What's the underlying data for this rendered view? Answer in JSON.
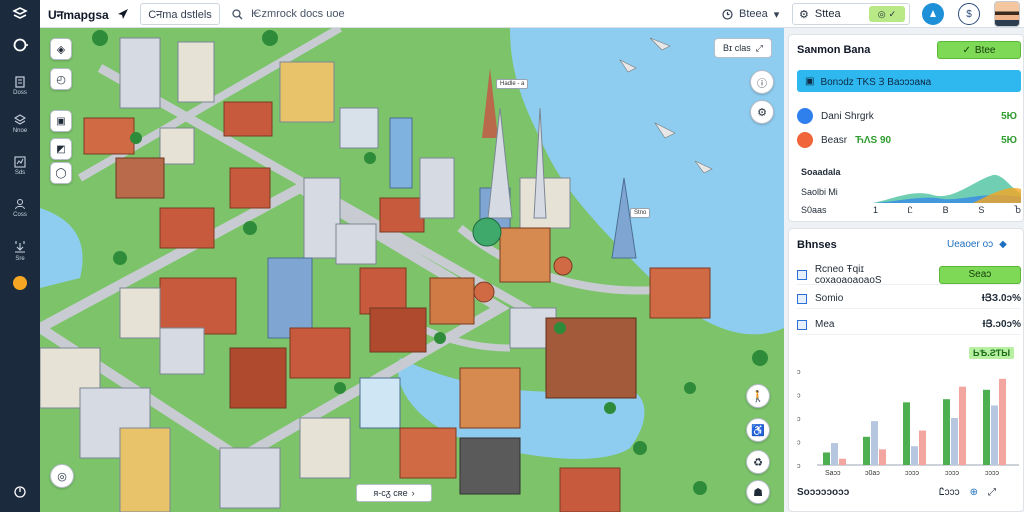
{
  "app": {
    "title": "Uनmapgsa",
    "tab_label": "Cनma dstlels",
    "search_placeholder": "Ѥzmrock docs uoe",
    "mode_label": "Bteea",
    "status_label": "Sttea"
  },
  "rail": {
    "items": [
      {
        "label": "",
        "icon": "hub-icon"
      },
      {
        "label": "Doss",
        "icon": "building-icon"
      },
      {
        "label": "Nnoe",
        "icon": "layers-icon"
      },
      {
        "label": "Sds",
        "icon": "chart-icon"
      },
      {
        "label": "Coss",
        "icon": "people-icon"
      },
      {
        "label": "Sre",
        "icon": "download-icon"
      },
      {
        "label": "",
        "icon": "coin-icon"
      },
      {
        "label": "",
        "icon": "power-icon"
      }
    ]
  },
  "map": {
    "zoom_label": "Bɪ clas",
    "coords_label": "ᴙ-cᵹ cʀe",
    "labels": [
      "Hadle - a",
      "Stno"
    ]
  },
  "panel": {
    "overview": {
      "title": "Ѕaɴmon Bana",
      "button_label": "Btee",
      "banner_text": "Bonɔdz TKЅ Ɜ Baɔɔɔaɴa",
      "rows": [
        {
          "label": "Dani Shrgrk",
          "value": "5Ю",
          "color": "#2f80ed"
        },
        {
          "label": "Beasr",
          "extra": "ЋɅЅ 90",
          "value": "5Ю",
          "color": "#f0653a"
        }
      ],
      "chart_title": "Ѕoaadala",
      "chart_rows": [
        "Ѕaolbi Ꮇi",
        "Ѕ0aas"
      ],
      "chart_ticks": [
        "1",
        "Ꮭ",
        "В",
        "Ѕ",
        "Ⴆ"
      ]
    },
    "stats": {
      "title": "Bhnses",
      "link_label": "Ueaoer oɔ",
      "rows": [
        {
          "label": "Rcneo Ŧqiɪ coxaoaoaoaoЅ",
          "button": "Seaɔ"
        },
        {
          "label": "Ѕomio",
          "value": "ƗՅЗ.0ɔ%"
        },
        {
          "label": "Mea",
          "value": "ƗՅ.ɔ0ɔ%"
        }
      ],
      "highlight_value": "ЬѢ.ƧƬЫ"
    },
    "bar_chart": {
      "type": "bar",
      "categories": [
        "Ѕaɔɔ",
        "ɔ0aɔ",
        "ɔɔɔɔ",
        "ɔɔɔɔ",
        "ɔɔɔɔ"
      ],
      "series": [
        {
          "values": [
            8,
            18,
            40,
            42,
            48
          ],
          "color": "#4caf50"
        },
        {
          "values": [
            14,
            28,
            12,
            30,
            38
          ],
          "color": "#b8c7e0"
        },
        {
          "values": [
            4,
            10,
            22,
            50,
            55
          ],
          "color": "#f3a5a0"
        }
      ],
      "y_ticks": [
        "ɔ",
        "ɔ",
        "ɔ",
        "ɔ",
        "ɔ"
      ]
    },
    "footer_label": "Ѕoɔɔɔɔoɔɔ",
    "footer_value": "Ꮭɔɔɔ"
  },
  "colors": {
    "rail_bg": "#1b2a3d",
    "accent_green": "#7ed957",
    "accent_blue": "#2fb8f0"
  }
}
